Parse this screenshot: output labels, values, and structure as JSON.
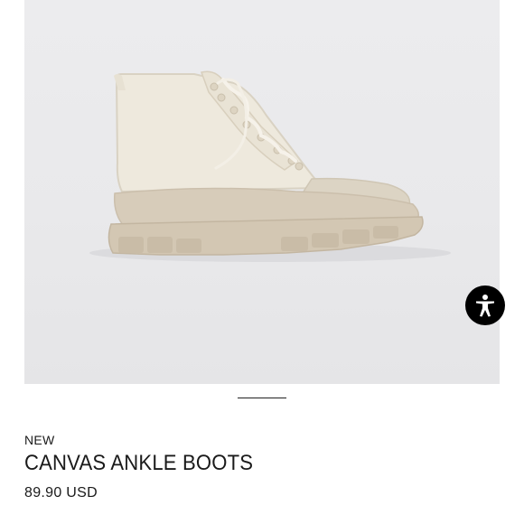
{
  "product": {
    "image_icon": "canvas-ankle-boot-photo",
    "badge": "NEW",
    "name": "CANVAS ANKLE BOOTS",
    "price": "89.90 USD"
  },
  "gallery": {
    "pager_icon": "carousel-indicator"
  },
  "accessibility": {
    "icon": "accessibility-person-icon",
    "color": "#000000"
  }
}
